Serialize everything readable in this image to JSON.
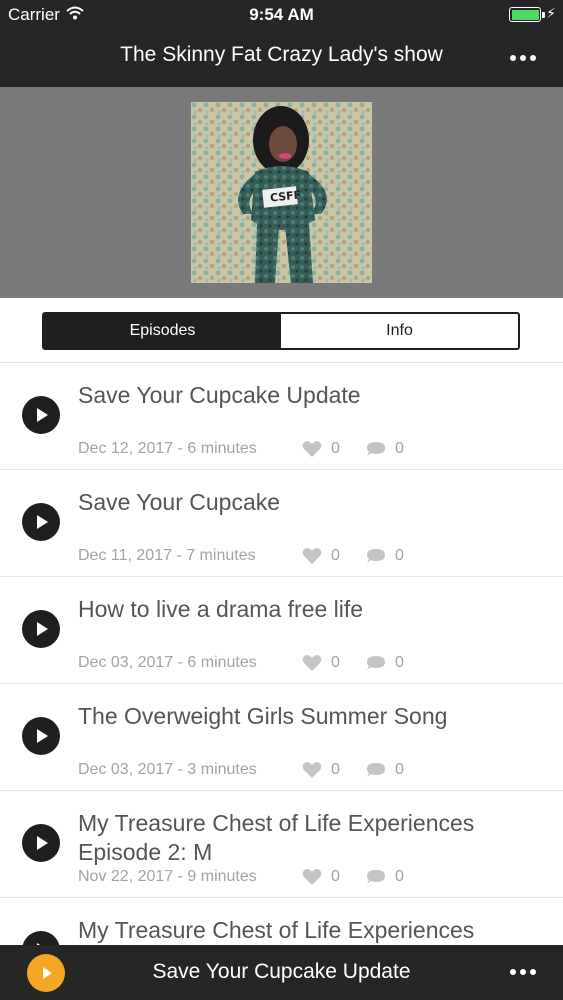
{
  "status_bar": {
    "carrier": "Carrier",
    "time": "9:54 AM",
    "battery_color": "#4cd964"
  },
  "nav": {
    "title": "The Skinny Fat Crazy Lady's show",
    "more_icon": "more-icon"
  },
  "cover": {
    "shirt_text": "CSFF"
  },
  "tabs": [
    {
      "label": "Episodes",
      "active": true
    },
    {
      "label": "Info",
      "active": false
    }
  ],
  "episodes": [
    {
      "title": "Save Your Cupcake Update",
      "meta": "Dec 12, 2017 - 6 minutes",
      "likes": "0",
      "comments": "0"
    },
    {
      "title": "Save Your Cupcake",
      "meta": "Dec 11, 2017 - 7 minutes",
      "likes": "0",
      "comments": "0"
    },
    {
      "title": "How to live a drama free life",
      "meta": "Dec 03, 2017 - 6 minutes",
      "likes": "0",
      "comments": "0"
    },
    {
      "title": "The Overweight Girls Summer Song",
      "meta": "Dec 03, 2017 - 3 minutes",
      "likes": "0",
      "comments": "0"
    },
    {
      "title": "My Treasure Chest of Life Experiences Episode 2: M",
      "meta": "Nov 22, 2017 - 9 minutes",
      "likes": "0",
      "comments": "0"
    },
    {
      "title": "My Treasure Chest of Life Experiences",
      "meta": "",
      "likes": "",
      "comments": ""
    }
  ],
  "player": {
    "now_playing": "Save Your Cupcake Update",
    "accent": "#f5a623"
  },
  "colors": {
    "bar_background": "#262626",
    "hero_background": "#7a7a7a"
  }
}
